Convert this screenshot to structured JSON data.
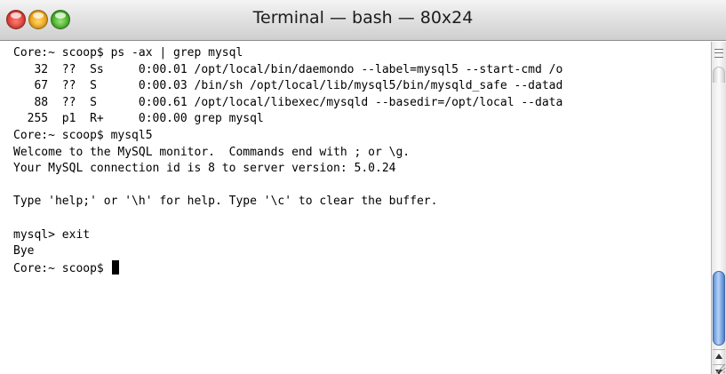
{
  "window": {
    "title": "Terminal — bash — 80x24"
  },
  "terminal": {
    "lines": [
      "Core:~ scoop$ ps -ax | grep mysql",
      "   32  ??  Ss     0:00.01 /opt/local/bin/daemondo --label=mysql5 --start-cmd /o",
      "   67  ??  S      0:00.03 /bin/sh /opt/local/lib/mysql5/bin/mysqld_safe --datad",
      "   88  ??  S      0:00.61 /opt/local/libexec/mysqld --basedir=/opt/local --data",
      "  255  p1  R+     0:00.00 grep mysql",
      "Core:~ scoop$ mysql5",
      "Welcome to the MySQL monitor.  Commands end with ; or \\g.",
      "Your MySQL connection id is 8 to server version: 5.0.24",
      "",
      "Type 'help;' or '\\h' for help. Type '\\c' to clear the buffer.",
      "",
      "mysql> exit",
      "Bye",
      "Core:~ scoop$ "
    ]
  },
  "icons": {
    "close": "close-window-icon",
    "minimize": "minimize-window-icon",
    "zoom": "zoom-window-icon",
    "split": "split-pane-icon",
    "scroll_up": "scroll-up-arrow-icon",
    "scroll_down": "scroll-down-arrow-icon",
    "resize": "resize-grip-icon"
  },
  "colors": {
    "close": "#e0443a",
    "minimize": "#f2a91e",
    "zoom": "#4cb52c",
    "scroll_thumb": "#5f91d8",
    "text": "#000000",
    "background": "#ffffff"
  }
}
